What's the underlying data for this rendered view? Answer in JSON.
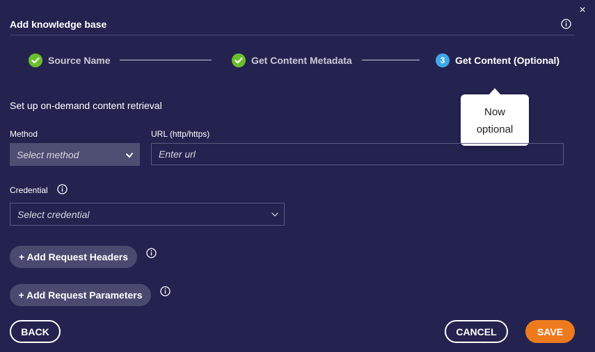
{
  "dialog": {
    "title": "Add knowledge base",
    "close_glyph": "×"
  },
  "steps": [
    {
      "label": "Source Name",
      "status": "complete",
      "icon": "check-circle-icon"
    },
    {
      "label": "Get Content Metadata",
      "status": "complete",
      "icon": "check-circle-icon"
    },
    {
      "label": "Get Content (Optional)",
      "status": "active",
      "number": "3"
    }
  ],
  "tooltip": {
    "line1": "Now",
    "line2": "optional"
  },
  "form": {
    "section_title": "Set up on-demand content retrieval",
    "method": {
      "label": "Method",
      "placeholder": "Select method"
    },
    "url": {
      "label": "URL (http/https)",
      "placeholder": "Enter url",
      "value": ""
    },
    "credential": {
      "label": "Credential",
      "placeholder": "Select credential"
    },
    "add_headers_label": "+ Add Request Headers",
    "add_params_label": "+ Add Request Parameters"
  },
  "footer": {
    "back_label": "BACK",
    "cancel_label": "CANCEL",
    "save_label": "SAVE"
  },
  "colors": {
    "background": "#24234f",
    "check_green": "#6abf2a",
    "step_active_blue": "#3fa9e8",
    "save_orange": "#ee7a1e"
  }
}
